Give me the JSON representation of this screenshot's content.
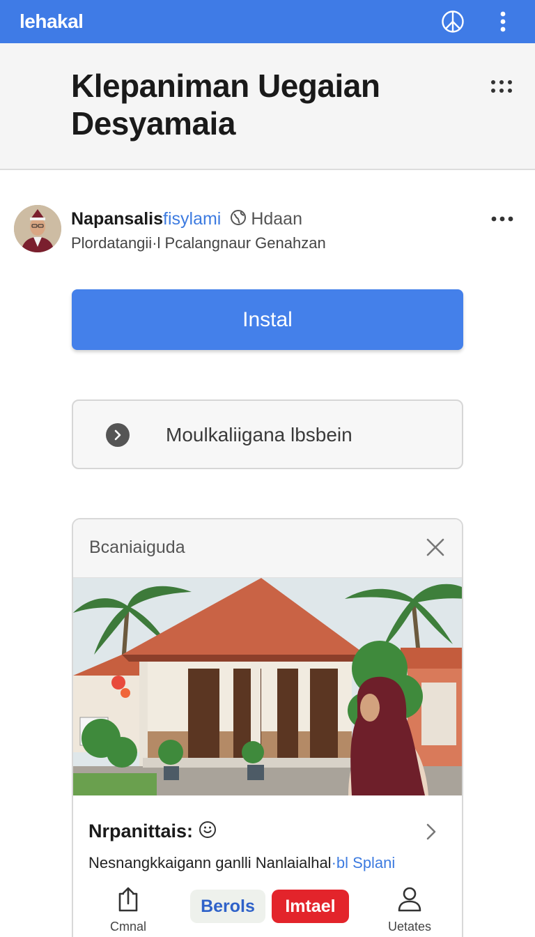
{
  "appbar": {
    "title": "lehakal",
    "icons": [
      "peace-icon",
      "more-vert-icon"
    ],
    "color": "#3f7be6"
  },
  "header": {
    "title": "Klepaniman Uegaian Desyamaia"
  },
  "author": {
    "name": "Napansalis",
    "link": "fisylami",
    "meta": "Hdaan",
    "subtitle": "Plordatangii·l Pcalangnaur Genahzan"
  },
  "install_button": {
    "label": "Instal",
    "color": "#4480ea"
  },
  "secondary_button": {
    "label": "Moulkaliigana lbsbein"
  },
  "card": {
    "header": "Bcaniaiguda",
    "title": "Nrpanittais:",
    "description": "Nesnangkkaigann ganlli Nanlaialhal",
    "description_link": "·bl Splani"
  },
  "bottom_bar": {
    "share_label": "Cmnal",
    "pill_blue": "Berols",
    "pill_red": "Imtael",
    "updates_label": "Uetates",
    "red_color": "#e3242b"
  }
}
